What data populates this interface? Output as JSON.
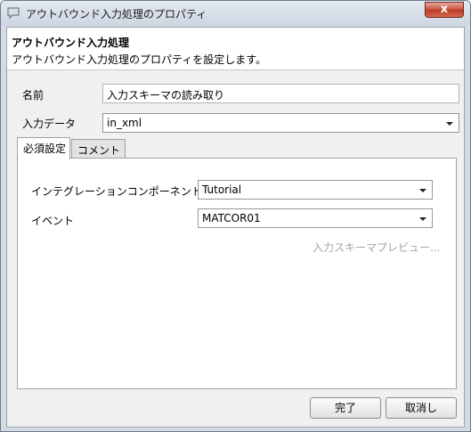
{
  "window": {
    "title": "アウトバウンド入力処理のプロパティ",
    "icon": "speech-bubble-icon",
    "close_label": "x"
  },
  "header": {
    "title": "アウトバウンド入力処理",
    "description": "アウトバウンド入力処理のプロパティを設定します。"
  },
  "form": {
    "name_label": "名前",
    "name_value": "入力スキーマの読み取り",
    "input_data_label": "入力データ",
    "input_data_value": "in_xml"
  },
  "tabs": [
    {
      "label": "必須設定",
      "active": true
    },
    {
      "label": "コメント",
      "active": false
    }
  ],
  "required_tab": {
    "component_label": "インテグレーションコンポーネント",
    "component_value": "Tutorial",
    "event_label": "イベント",
    "event_value": "MATCOR01",
    "preview_link": "入力スキーマプレビュー..."
  },
  "buttons": {
    "finish": "完了",
    "cancel": "取消し"
  },
  "colors": {
    "title_bar": "#cdd6e1",
    "close_button": "#c9503c",
    "disabled_text": "#a5a5a5"
  }
}
